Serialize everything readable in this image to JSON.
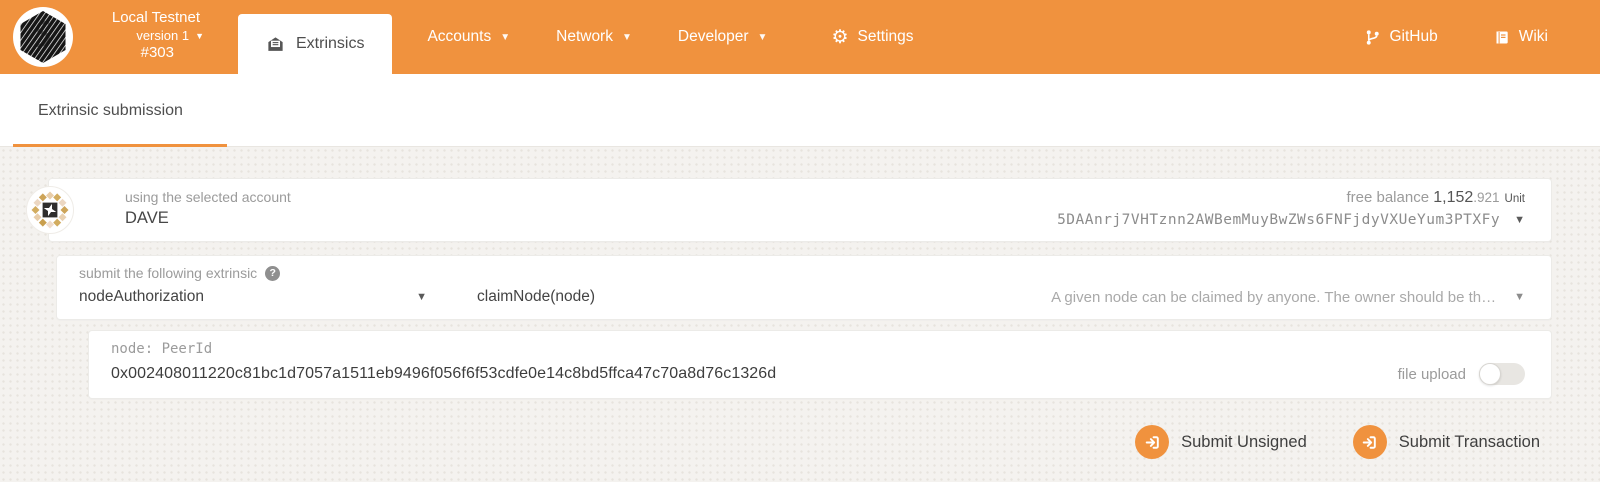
{
  "colors": {
    "accent": "#f0923e",
    "header_bg": "#f0923e"
  },
  "header": {
    "chain_name": "Local Testnet",
    "chain_version": "version 1",
    "block_number": "#303",
    "active_tab": "Extrinsics",
    "nav_items": [
      {
        "label": "Accounts"
      },
      {
        "label": "Network"
      },
      {
        "label": "Developer"
      },
      {
        "label": "Settings"
      }
    ],
    "links": [
      {
        "label": "GitHub"
      },
      {
        "label": "Wiki"
      }
    ]
  },
  "subnav": {
    "active_tab": "Extrinsic submission"
  },
  "account_section": {
    "label": "using the selected account",
    "account_name": "DAVE",
    "balance_label": "free balance",
    "balance_int": "1,152",
    "balance_frac": ".921",
    "balance_unit": "Unit",
    "address": "5DAAnrj7VHTznn2AWBemMuyBwZWs6FNFjdyVXUeYum3PTXFy"
  },
  "extrinsic_section": {
    "label": "submit the following extrinsic",
    "pallet": "nodeAuthorization",
    "method": "claimNode(node)",
    "description": "A given node can be claimed by anyone. The owner should be th…"
  },
  "param_section": {
    "label": "node: PeerId",
    "value": "0x002408011220c81bc1d7057a1511eb9496f056f6f53cdfe0e14c8bd5ffca47c70a8d76c1326d",
    "file_upload_label": "file upload",
    "file_upload_on": "false"
  },
  "actions": {
    "submit_unsigned": "Submit Unsigned",
    "submit_transaction": "Submit Transaction"
  }
}
